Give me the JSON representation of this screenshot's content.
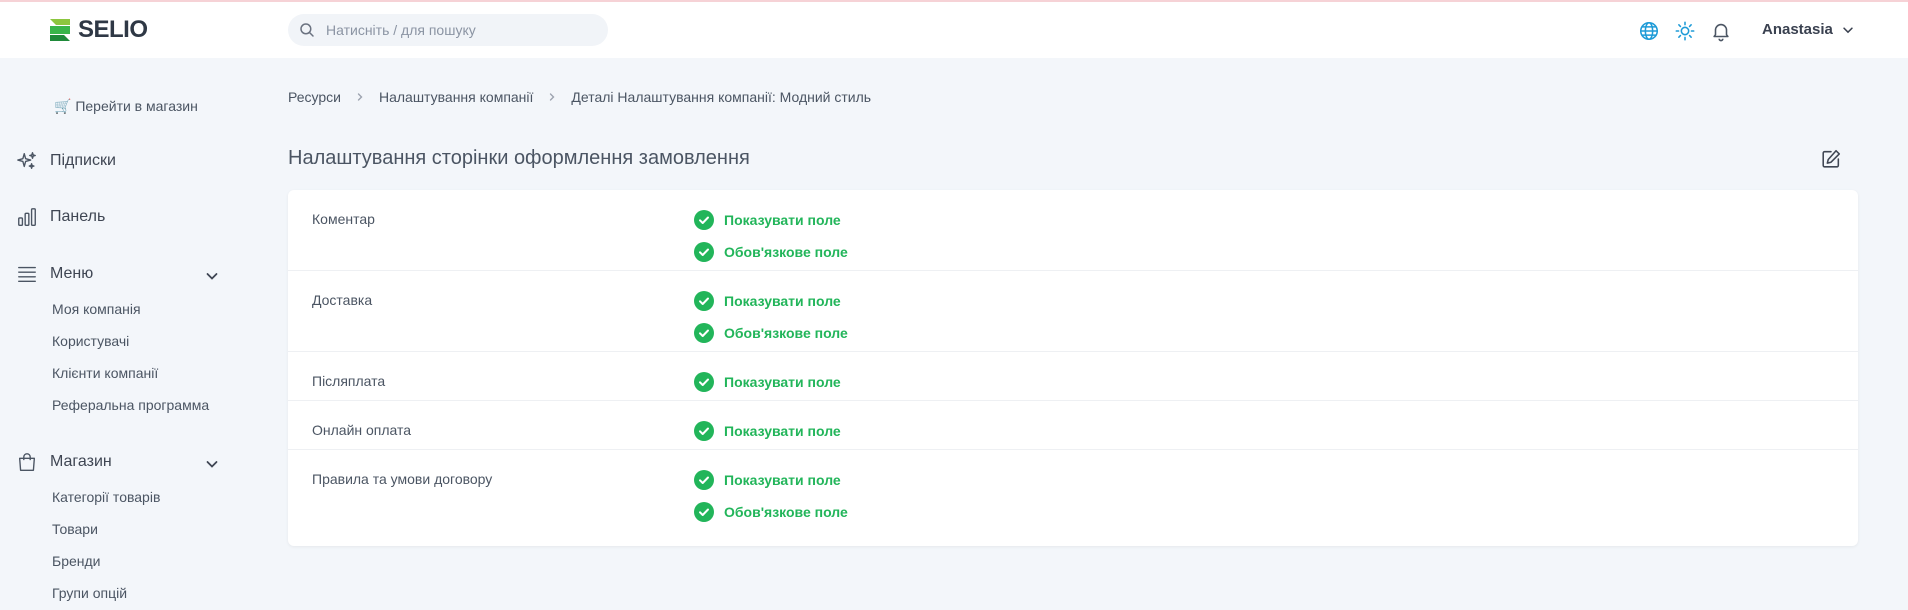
{
  "header": {
    "logo_text": "SELIO",
    "search_placeholder": "Натисніть / для пошуку",
    "user_name": "Anastasia",
    "icons": [
      "globe-icon",
      "sun-icon",
      "bell-icon"
    ]
  },
  "sidebar": {
    "store_link": "🛒 Перейти в магазин",
    "subscriptions": "Підписки",
    "panel": "Панель",
    "menu": {
      "label": "Меню",
      "items": [
        "Моя компанія",
        "Користувачі",
        "Клієнти компанії",
        "Реферальна программа"
      ]
    },
    "shop": {
      "label": "Магазин",
      "items": [
        "Категорії товарів",
        "Товари",
        "Бренди",
        "Групи опцій"
      ]
    }
  },
  "breadcrumbs": [
    "Ресурси",
    "Налаштування компанії",
    "Деталі Налаштування компанії: Модний стиль"
  ],
  "page_title": "Налаштування сторінки оформлення замовлення",
  "settings": [
    {
      "label": "Коментар",
      "badges": [
        "Показувати поле",
        "Обов'язкове поле"
      ]
    },
    {
      "label": "Доставка",
      "badges": [
        "Показувати поле",
        "Обов'язкове поле"
      ]
    },
    {
      "label": "Післяплата",
      "badges": [
        "Показувати поле"
      ]
    },
    {
      "label": "Онлайн оплата",
      "badges": [
        "Показувати поле"
      ]
    },
    {
      "label": "Правила та умови договору",
      "badges": [
        "Показувати поле",
        "Обов'язкове поле"
      ]
    }
  ],
  "colors": {
    "accent_green": "#22b55a",
    "icon_blue": "#1e9bd7",
    "background": "#f3f6fa"
  }
}
